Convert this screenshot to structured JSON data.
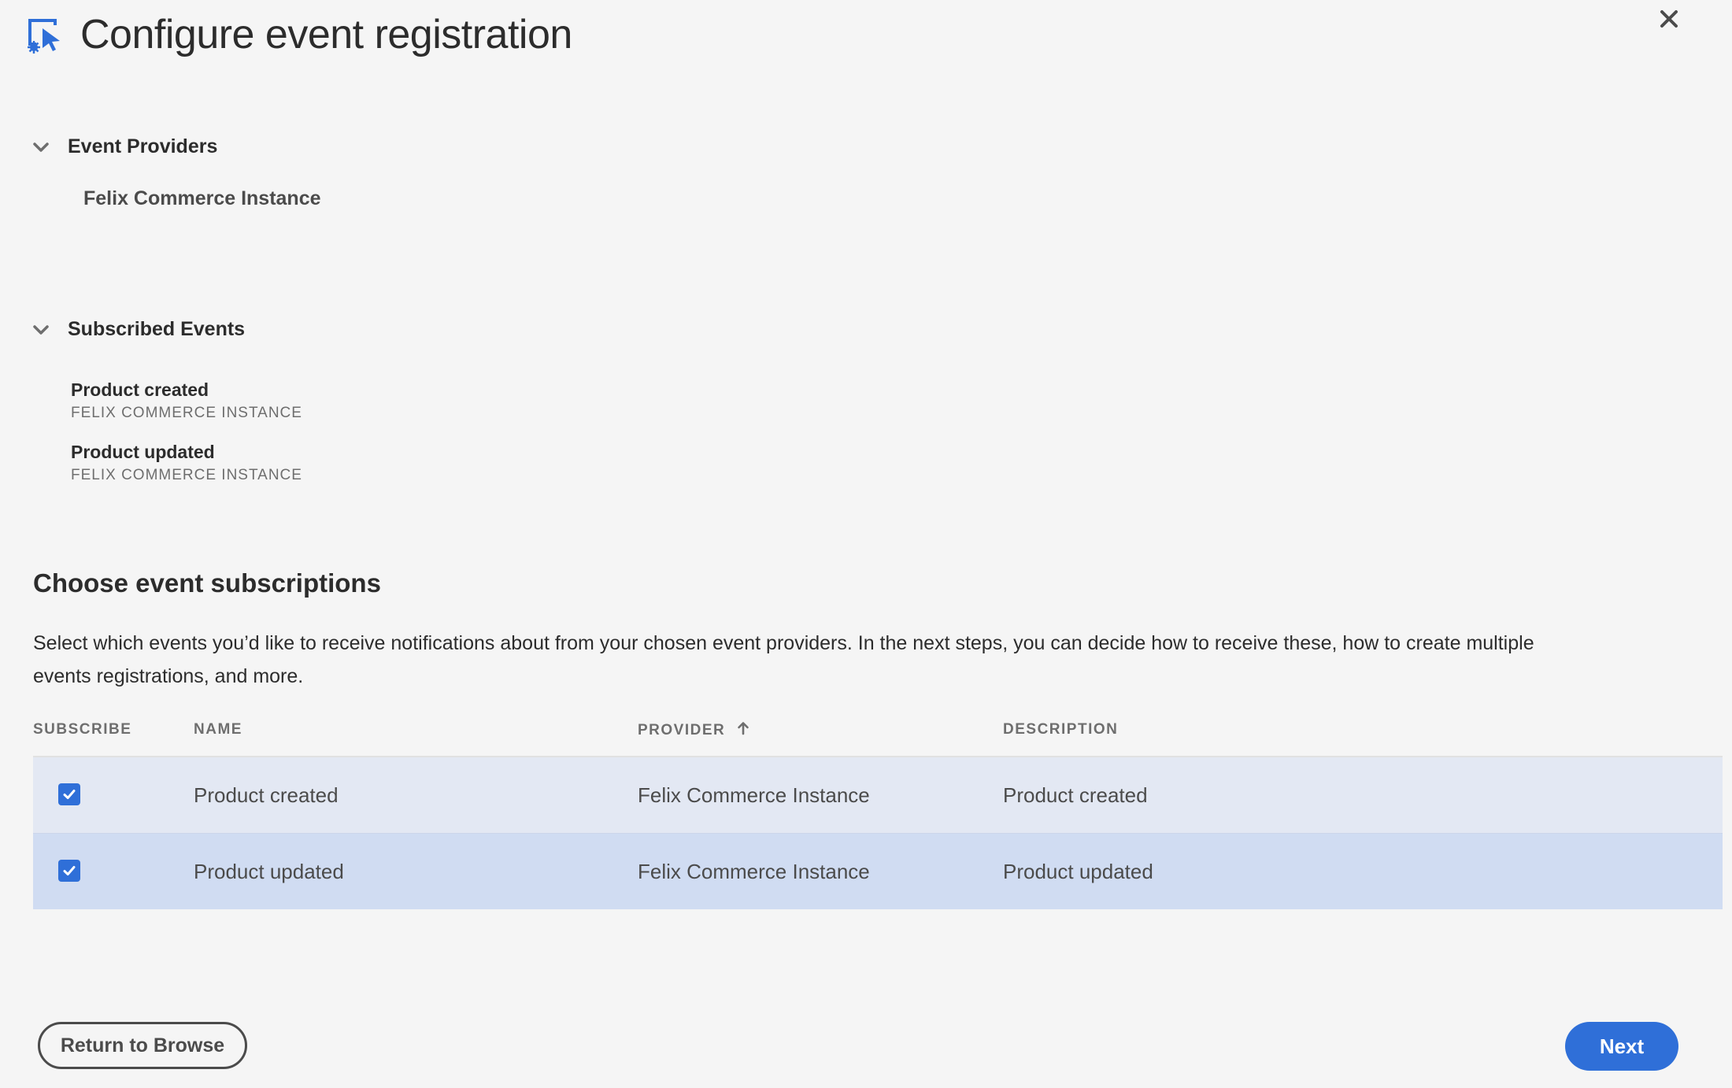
{
  "header": {
    "title": "Configure event registration",
    "icon": "event-registration-icon"
  },
  "sections": {
    "event_providers": {
      "label": "Event Providers",
      "providers": [
        "Felix Commerce Instance"
      ]
    },
    "subscribed_events": {
      "label": "Subscribed Events",
      "items": [
        {
          "name": "Product created",
          "provider": "FELIX COMMERCE INSTANCE"
        },
        {
          "name": "Product updated",
          "provider": "FELIX COMMERCE INSTANCE"
        }
      ]
    }
  },
  "subscriptions": {
    "heading": "Choose event subscriptions",
    "description": "Select which events you’d like to receive notifications about from your chosen event providers. In the next steps, you can decide how to receive these, how to create multiple events registrations, and more.",
    "columns": {
      "subscribe": "SUBSCRIBE",
      "name": "NAME",
      "provider": "PROVIDER",
      "description": "DESCRIPTION"
    },
    "rows": [
      {
        "checked": true,
        "name": "Product created",
        "provider": "Felix Commerce Instance",
        "description": "Product created"
      },
      {
        "checked": true,
        "name": "Product updated",
        "provider": "Felix Commerce Instance",
        "description": "Product updated"
      }
    ]
  },
  "footer": {
    "return_label": "Return to Browse",
    "next_label": "Next"
  },
  "colors": {
    "accent": "#2f6fd8",
    "row_alt": "#d0dcf2",
    "row": "#e3e8f3",
    "background": "#f5f5f5"
  }
}
